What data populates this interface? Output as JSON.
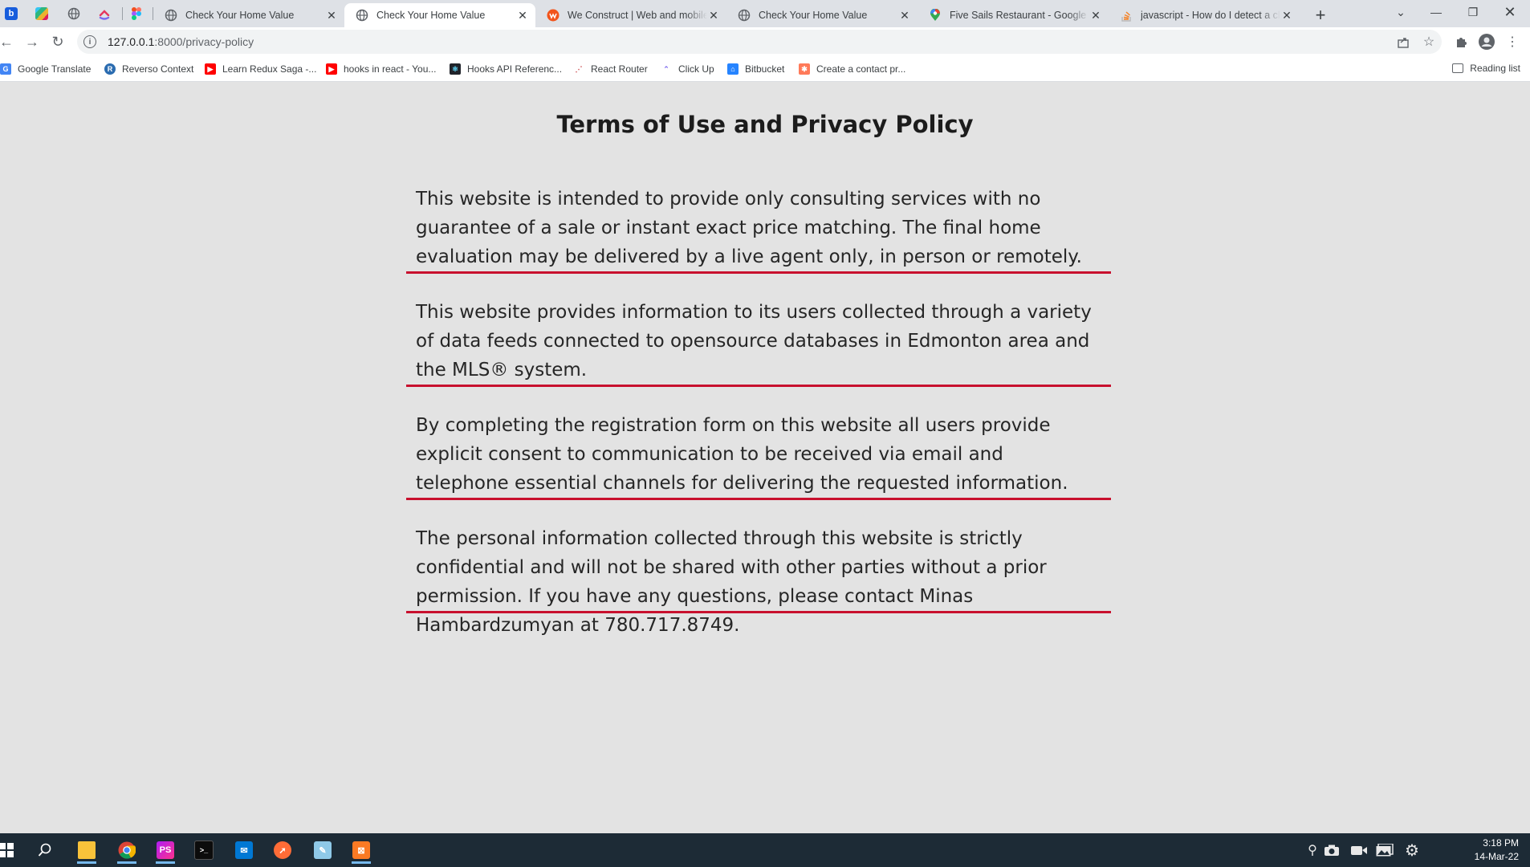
{
  "browser": {
    "tabs": [
      {
        "title": "Check Your Home Value",
        "favicon": "globe-icon",
        "active": false
      },
      {
        "title": "Check Your Home Value",
        "favicon": "globe-icon",
        "active": true
      },
      {
        "title": "We Construct | Web and mobile development",
        "favicon": "weconstruct-icon",
        "active": false
      },
      {
        "title": "Check Your Home Value",
        "favicon": "globe-icon",
        "active": false
      },
      {
        "title": "Five Sails Restaurant - Google Maps",
        "favicon": "maps-pin-icon",
        "active": false
      },
      {
        "title": "javascript - How do I detect a click outside an element",
        "favicon": "stackoverflow-icon",
        "active": false
      }
    ],
    "url_host": "127.0.0.1",
    "url_rest": ":8000/privacy-policy",
    "bookmarks": [
      {
        "label": "Google Translate",
        "color": "#4285f4"
      },
      {
        "label": "Reverso Context",
        "color": "#2b6cb0"
      },
      {
        "label": "Learn Redux Saga -...",
        "color": "#ff0000"
      },
      {
        "label": "hooks in react - You...",
        "color": "#ff0000"
      },
      {
        "label": "Hooks API Referenc...",
        "color": "#20232a"
      },
      {
        "label": "React Router",
        "color": "#ca4245"
      },
      {
        "label": "Click Up",
        "color": "#7b68ee"
      },
      {
        "label": "Bitbucket",
        "color": "#2684ff"
      },
      {
        "label": "Create a contact pr...",
        "color": "#ff7a59"
      }
    ],
    "reading_list": "Reading list"
  },
  "page": {
    "title": "Terms of Use and Privacy Policy",
    "paragraphs": [
      "This website is intended to provide only consulting services with no guarantee of a sale or instant exact price matching. The final home evaluation may be delivered by a live agent only, in person or remotely.",
      "This website provides information to its users collected through a variety of data feeds connected to opensource databases in Edmonton area and the MLS® system.",
      "By completing the registration form on this website all users provide explicit consent to communication to be received via email and telephone essential channels for delivering the requested information.",
      "The personal information collected through this website is strictly confidential and will not be shared with other parties without a prior permission. If you have any questions, please contact Minas Hambardzumyan at 780.717.8749."
    ],
    "accent_color": "#c8102e",
    "background": "#e3e3e3"
  },
  "taskbar": {
    "time": "3:18 PM",
    "date": "14-Mar-22"
  }
}
